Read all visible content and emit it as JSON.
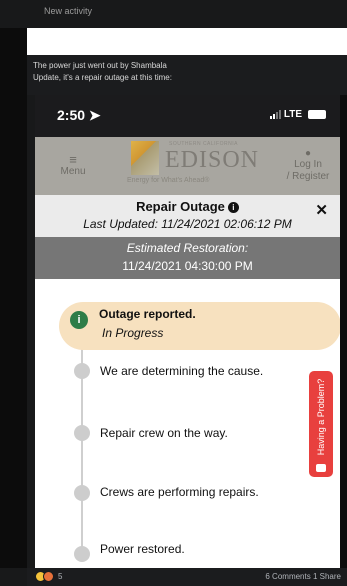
{
  "facebook": {
    "activity_label": "New activity",
    "post_line1": "The power just went out by Shambala",
    "post_line2": "Update, it's a repair outage at this time:",
    "reaction_count": "5",
    "comments": "6 Comments",
    "shares": "1 Share"
  },
  "phone": {
    "status_time": "2:50",
    "network": "LTE"
  },
  "header": {
    "menu_label": "Menu",
    "logo_small": "SOUTHERN CALIFORNIA",
    "logo_name": "EDISON",
    "logo_tagline": "Energy for What's Ahead®",
    "login_label_1": "Log In",
    "login_label_2": "/ Register"
  },
  "outage": {
    "title": "Repair Outage",
    "last_updated": "Last Updated: 11/24/2021 02:06:12 PM",
    "restoration_label": "Estimated Restoration:",
    "restoration_value": "11/24/2021 04:30:00 PM",
    "current_step": "Outage reported.",
    "current_status": "In Progress",
    "steps": [
      "We are determining the cause.",
      "Repair crew on the way.",
      "Crews are performing repairs.",
      "Power restored."
    ],
    "problem_tab": "Having a Problem?"
  },
  "colors": {
    "header_gray": "#a8a6a0",
    "current_step_bg": "#f7e1bf",
    "current_icon": "#2e7d48",
    "problem_tab": "#e8403e",
    "restoration_bg": "#767676"
  },
  "icons": [
    "location-arrow-icon",
    "signal-icon",
    "battery-icon",
    "menu-icon",
    "person-icon",
    "info-icon",
    "close-icon",
    "chat-icon",
    "reaction-icons"
  ]
}
